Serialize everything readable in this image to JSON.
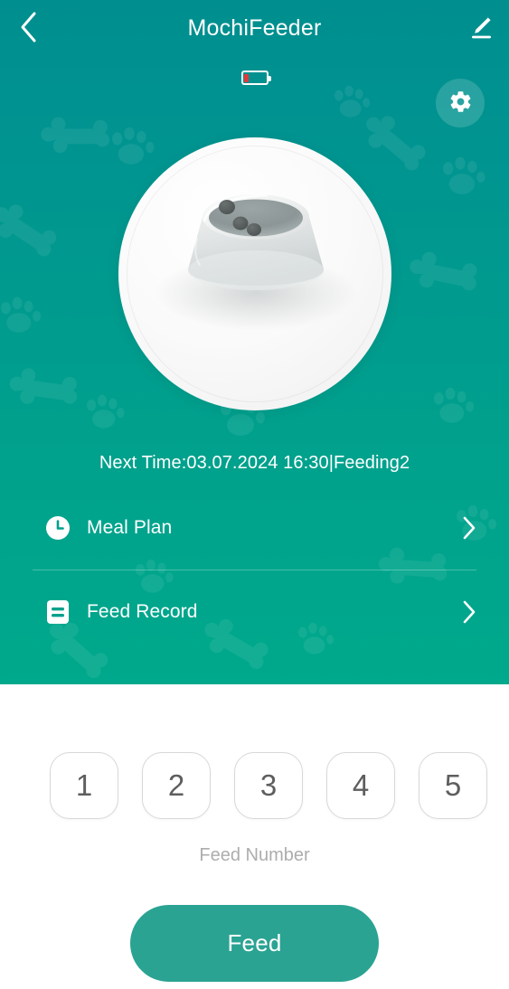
{
  "header": {
    "title": "MochiFeeder",
    "back_icon": "chevron-left-icon",
    "edit_icon": "pencil-edit-icon"
  },
  "status": {
    "battery_icon": "battery-low-icon",
    "battery_level_percent": 22,
    "battery_color": "#e03b3b"
  },
  "settings": {
    "gear_icon": "gear-icon"
  },
  "device": {
    "image_icon": "pet-food-bowl-illustration",
    "kibble_count": 3
  },
  "schedule": {
    "next_time_text": "Next Time:03.07.2024 16:30|Feeding2"
  },
  "menu": {
    "items": [
      {
        "label": "Meal Plan",
        "icon": "clock-icon",
        "chevron": "chevron-right-icon"
      },
      {
        "label": "Feed Record",
        "icon": "record-list-icon",
        "chevron": "chevron-right-icon"
      }
    ]
  },
  "feed_panel": {
    "chips": [
      "1",
      "2",
      "3",
      "4",
      "5"
    ],
    "selected_chip": null,
    "chips_label": "Feed Number",
    "feed_button_label": "Feed",
    "feed_button_color": "#2aa393"
  },
  "theme": {
    "teal_top": "#008e8f",
    "teal_bottom": "#00a98b",
    "sheet_background": "#ffffff",
    "chip_border": "#d8d8d8",
    "muted_text": "#adadad"
  }
}
